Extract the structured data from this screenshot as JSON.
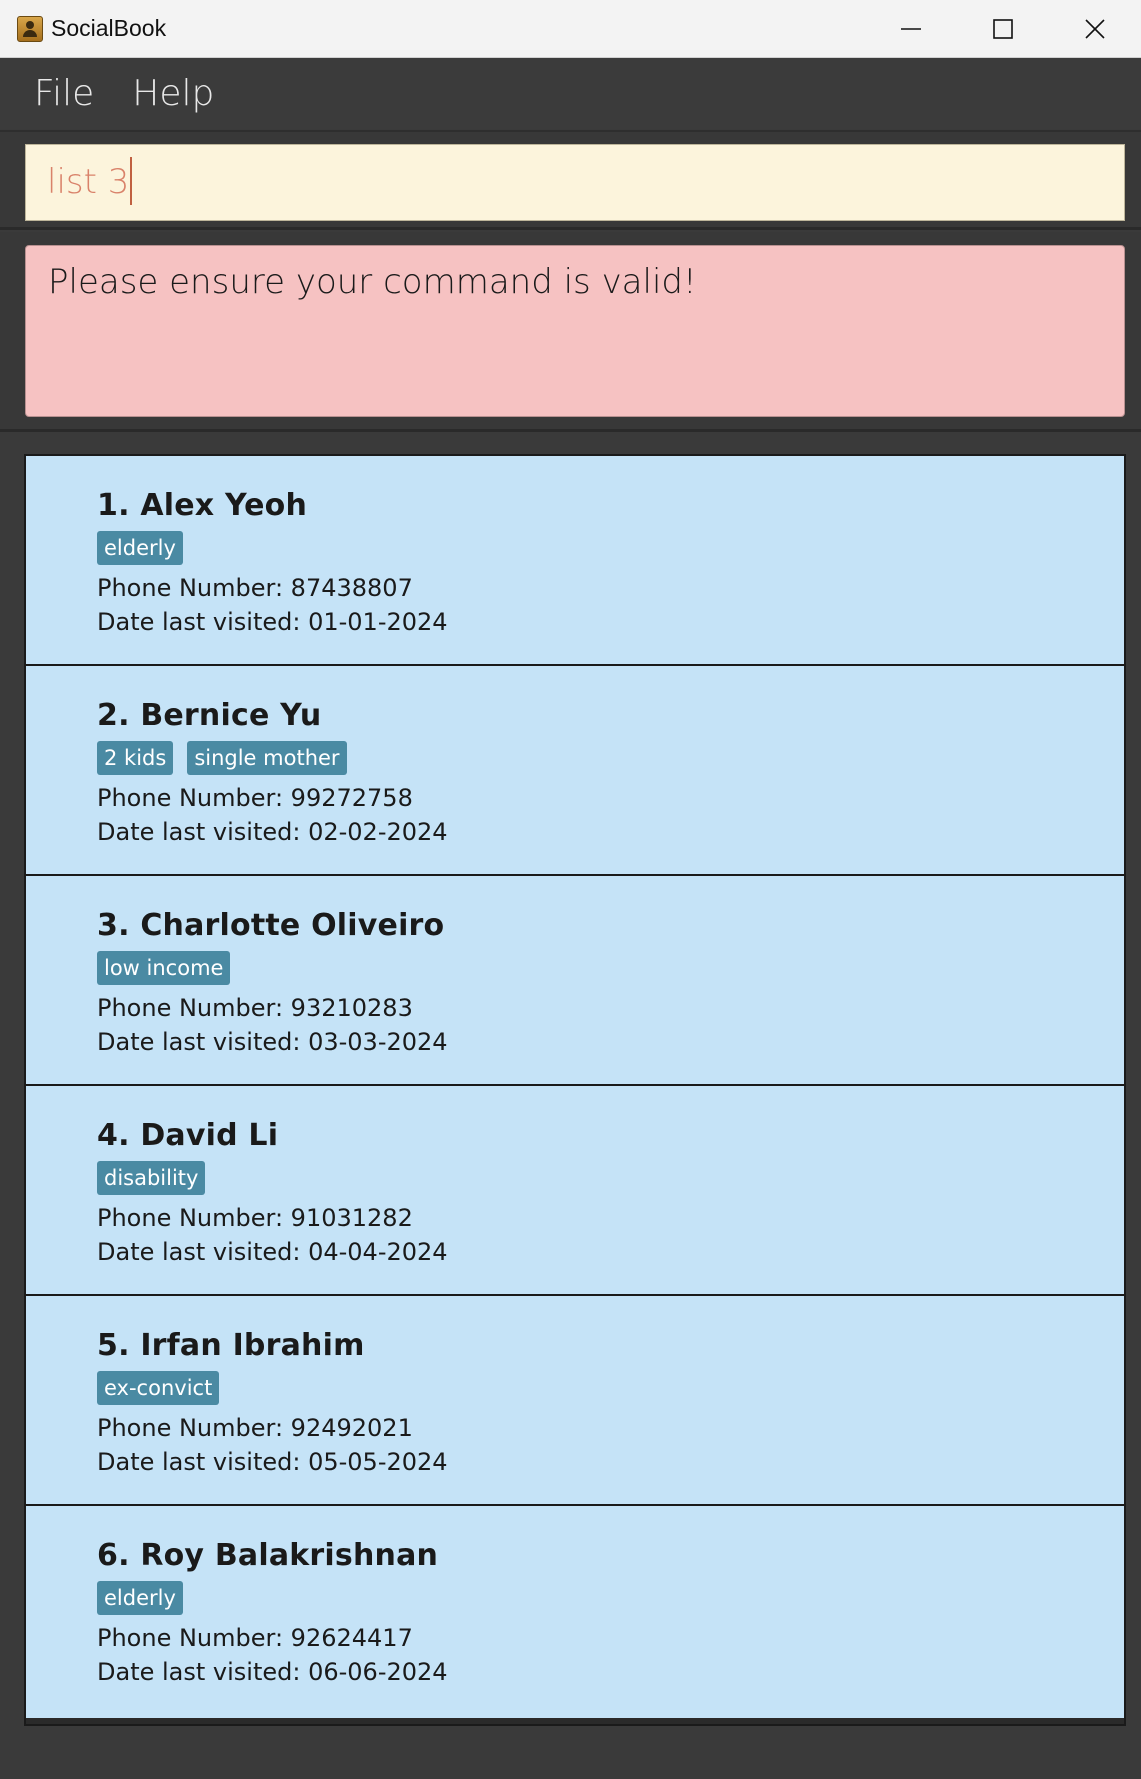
{
  "window": {
    "title": "SocialBook",
    "icons": {
      "app": "address-book-icon",
      "minimize": "minimize-icon",
      "maximize": "maximize-icon",
      "close": "close-icon"
    }
  },
  "menu": {
    "items": [
      "File",
      "Help"
    ]
  },
  "command": {
    "value": "list 3"
  },
  "result": {
    "message": "Please ensure your command is valid!"
  },
  "persons": [
    {
      "name": "1. Alex Yeoh",
      "tags": [
        "elderly"
      ],
      "phone": "Phone Number: 87438807",
      "visited": "Date last visited: 01-01-2024"
    },
    {
      "name": "2. Bernice Yu",
      "tags": [
        "2 kids",
        "single mother"
      ],
      "phone": "Phone Number: 99272758",
      "visited": "Date last visited: 02-02-2024"
    },
    {
      "name": "3. Charlotte Oliveiro",
      "tags": [
        "low income"
      ],
      "phone": "Phone Number: 93210283",
      "visited": "Date last visited: 03-03-2024"
    },
    {
      "name": "4. David Li",
      "tags": [
        "disability"
      ],
      "phone": "Phone Number: 91031282",
      "visited": "Date last visited: 04-04-2024"
    },
    {
      "name": "5. Irfan Ibrahim",
      "tags": [
        "ex-convict"
      ],
      "phone": "Phone Number: 92492021",
      "visited": "Date last visited: 05-05-2024"
    },
    {
      "name": "6. Roy Balakrishnan",
      "tags": [
        "elderly"
      ],
      "phone": "Phone Number: 92624417",
      "visited": "Date last visited: 06-06-2024"
    }
  ],
  "colors": {
    "card_bg": "#c5e3f7",
    "tag_bg": "#4a8aa3",
    "command_bg": "#fcf4dc",
    "command_text": "#d9826a",
    "error_bg": "#f6c2c2",
    "app_bg": "#3a3a3a"
  }
}
